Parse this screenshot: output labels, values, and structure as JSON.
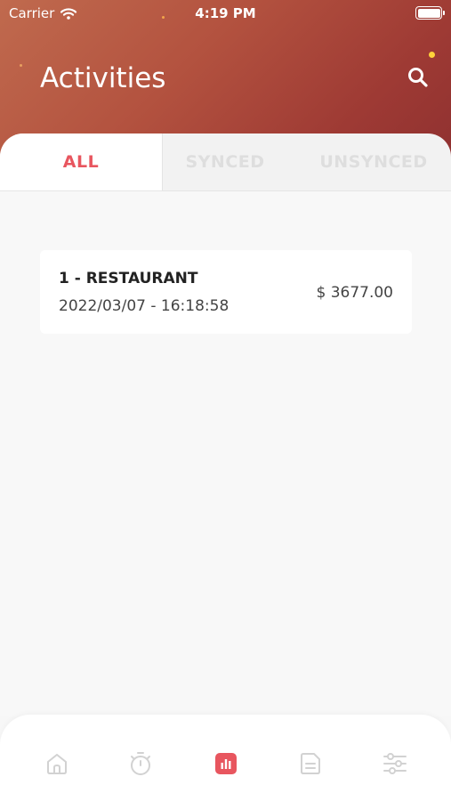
{
  "status_bar": {
    "carrier": "Carrier",
    "time": "4:19 PM"
  },
  "header": {
    "title": "Activities"
  },
  "tabs": [
    {
      "label": "ALL",
      "active": true
    },
    {
      "label": "SYNCED",
      "active": false
    },
    {
      "label": "UNSYNCED",
      "active": false
    }
  ],
  "activities": [
    {
      "title": "1 - RESTAURANT",
      "datetime": "2022/03/07 - 16:18:58",
      "amount": "$ 3677.00"
    }
  ],
  "bottom_nav": [
    {
      "icon": "home-icon",
      "active": false
    },
    {
      "icon": "timer-icon",
      "active": false
    },
    {
      "icon": "chart-icon",
      "active": true
    },
    {
      "icon": "document-icon",
      "active": false
    },
    {
      "icon": "sliders-icon",
      "active": false
    }
  ],
  "colors": {
    "accent": "#e8565f",
    "inactive_tab": "#dedede",
    "nav_inactive": "#d2d2d2"
  }
}
